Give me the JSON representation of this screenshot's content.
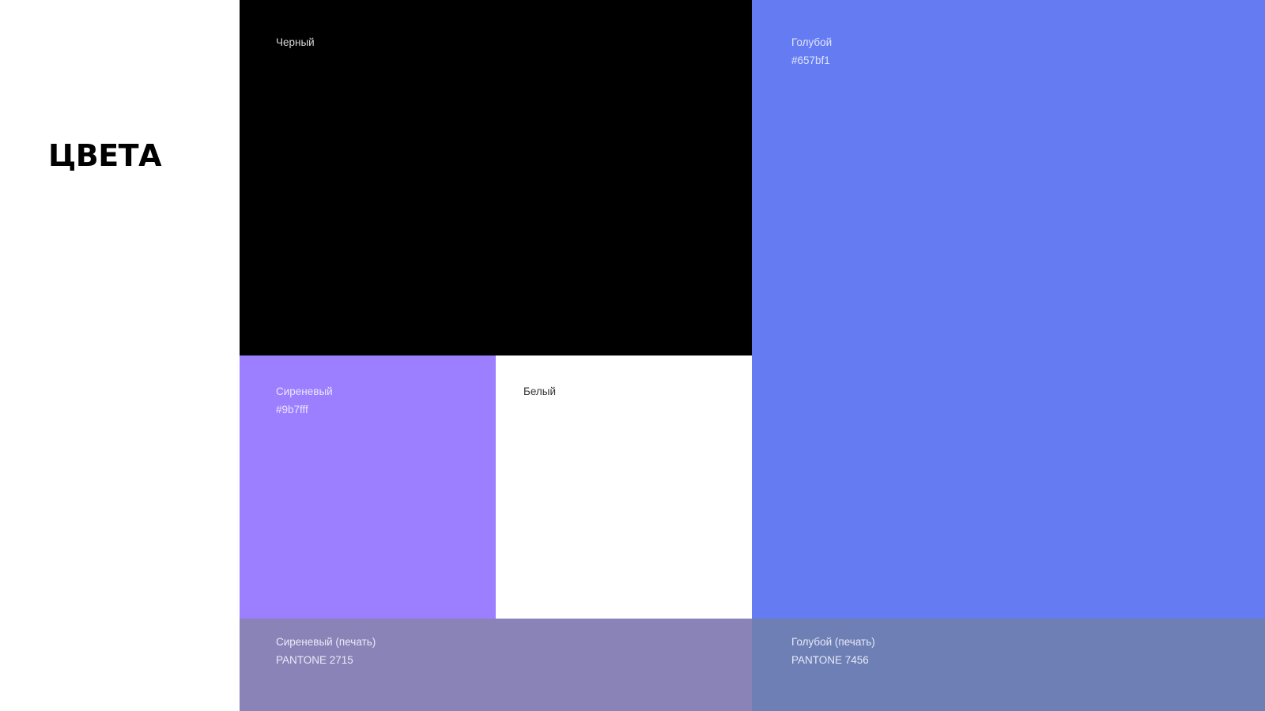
{
  "title": "ЦВЕТА",
  "swatches": {
    "black": {
      "name": "Черный",
      "color": "#000000"
    },
    "blue": {
      "name": "Голубой",
      "code": "#657bf1",
      "color": "#657bf1"
    },
    "lilac": {
      "name": "Сиреневый",
      "code": "#9b7fff",
      "color": "#9b7fff"
    },
    "white": {
      "name": "Белый",
      "color": "#ffffff"
    },
    "lilac_print": {
      "name": "Сиреневый (печать)",
      "code": "PANTONE 2715",
      "color": "#8a83b8"
    },
    "blue_print": {
      "name": "Голубой (печать)",
      "code": "PANTONE 7456",
      "color": "#6e7fb6"
    }
  }
}
